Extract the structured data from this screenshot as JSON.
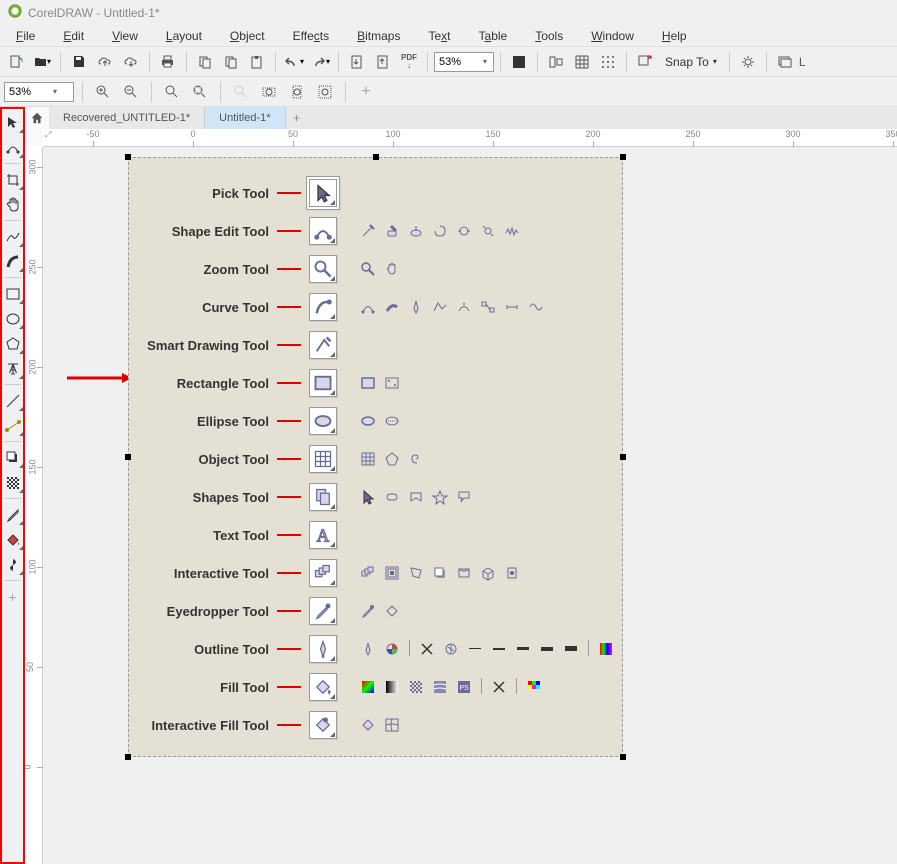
{
  "app": {
    "title": "CorelDRAW - Untitled-1*"
  },
  "menu": {
    "items": [
      "File",
      "Edit",
      "View",
      "Layout",
      "Object",
      "Effects",
      "Bitmaps",
      "Text",
      "Table",
      "Tools",
      "Window",
      "Help"
    ]
  },
  "toolbar": {
    "zoom_value": "53%",
    "pdf_label": "PDF",
    "snap_label": "Snap To"
  },
  "second_toolbar": {
    "zoom_value": "53%"
  },
  "tabs": {
    "items": [
      {
        "label": "Recovered_UNTITLED-1*",
        "active": false
      },
      {
        "label": "Untitled-1*",
        "active": true
      }
    ]
  },
  "ruler": {
    "h_ticks": [
      -50,
      0,
      50,
      100,
      150,
      200,
      250,
      300,
      350
    ],
    "v_ticks": [
      300,
      250,
      200,
      150,
      100,
      50,
      0
    ]
  },
  "tools": [
    {
      "label": "Pick Tool",
      "icon": "arrow",
      "highlighted": true,
      "flyouts": []
    },
    {
      "label": "Shape Edit Tool",
      "icon": "shape",
      "flyouts": [
        "knife",
        "erase",
        "smudge",
        "twirl",
        "attract",
        "repel",
        "roughen"
      ]
    },
    {
      "label": "Zoom Tool",
      "icon": "zoom",
      "flyouts": [
        "zoom",
        "pan"
      ]
    },
    {
      "label": "Curve Tool",
      "icon": "freehand",
      "flyouts": [
        "bezier",
        "artistic",
        "pen",
        "polyline",
        "3point",
        "connector",
        "dimension",
        "spline"
      ]
    },
    {
      "label": "Smart Drawing Tool",
      "icon": "smart",
      "flyouts": []
    },
    {
      "label": "Rectangle Tool",
      "icon": "rect",
      "flyouts": [
        "rect",
        "3rect"
      ]
    },
    {
      "label": "Ellipse Tool",
      "icon": "ellipse",
      "flyouts": [
        "ellipse",
        "3ellipse"
      ]
    },
    {
      "label": "Object Tool",
      "icon": "grid",
      "flyouts": [
        "grid",
        "polygon",
        "spiral"
      ]
    },
    {
      "label": "Shapes Tool",
      "icon": "basicshape",
      "flyouts": [
        "arrow",
        "flowchart",
        "banner",
        "star",
        "callout"
      ]
    },
    {
      "label": "Text Tool",
      "icon": "text",
      "flyouts": []
    },
    {
      "label": "Interactive Tool",
      "icon": "blend",
      "flyouts": [
        "blend",
        "contour",
        "distort",
        "dropshadow",
        "envelope",
        "extrude",
        "transparency"
      ]
    },
    {
      "label": "Eyedropper Tool",
      "icon": "eyedrop",
      "flyouts": [
        "eyedrop",
        "bucket"
      ]
    },
    {
      "label": "Outline Tool",
      "icon": "outline",
      "flyouts": [
        "pen",
        "color",
        "none",
        "hair",
        "pt1",
        "pt2",
        "pt3",
        "pt4",
        "pt5",
        "colorsel"
      ]
    },
    {
      "label": "Fill Tool",
      "icon": "fill",
      "flyouts": [
        "uniform",
        "fountain",
        "pattern",
        "texture",
        "postscript",
        "none",
        "colordock"
      ]
    },
    {
      "label": "Interactive Fill Tool",
      "icon": "ifill",
      "flyouts": [
        "interactive",
        "mesh"
      ]
    }
  ]
}
